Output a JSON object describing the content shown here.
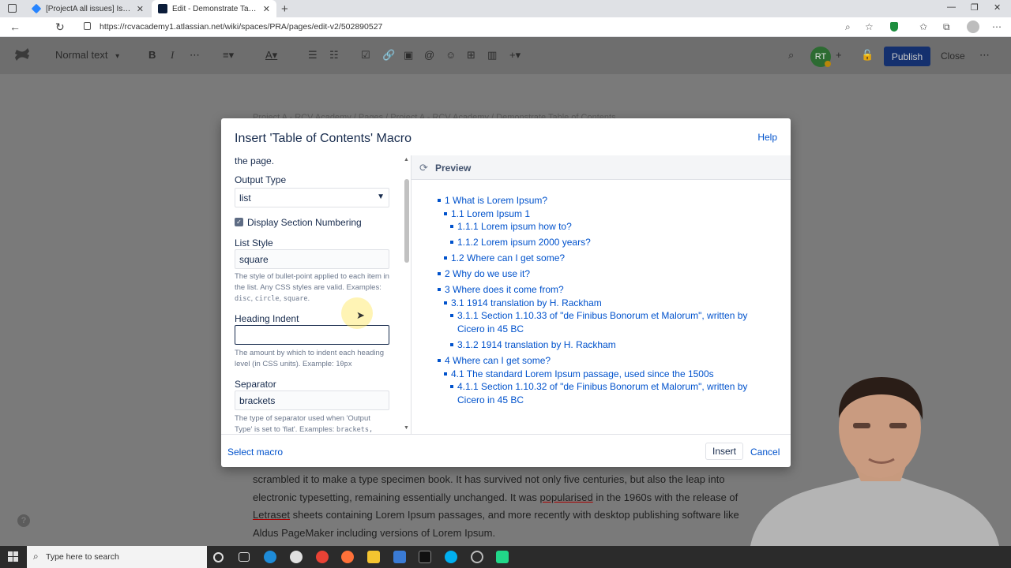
{
  "browser": {
    "tabs": [
      {
        "title": "[ProjectA all issues] Issue navigat",
        "icon": "jira-icon",
        "active": false
      },
      {
        "title": "Edit - Demonstrate Table of Cont",
        "icon": "confluence-icon",
        "active": true
      }
    ],
    "new_tab": "+",
    "url": "https://rcvacademy1.atlassian.net/wiki/spaces/PRA/pages/edit-v2/502890527"
  },
  "editor_toolbar": {
    "text_style": "Normal text",
    "avatar_initials": "RT",
    "publish_label": "Publish",
    "close_label": "Close"
  },
  "page": {
    "breadcrumb": "Project A - RCV Academy   /   Pages   /   Project A - RCV Academy   /   Demonstrate Table of Contents",
    "body_lines": [
      "scrambled it to make a type specimen book. It has survived not only five centuries, but also the leap into",
      "electronic typesetting, remaining essentially unchanged. It was ",
      "popularised",
      " in the 1960s with the release of",
      "Letraset",
      " sheets containing Lorem Ipsum passages, and more recently with desktop publishing software like",
      "Aldus PageMaker including versions of Lorem Ipsum."
    ]
  },
  "dialog": {
    "title": "Insert 'Table of Contents' Macro",
    "help_label": "Help",
    "left": {
      "top_text": "the page.",
      "output_type_label": "Output Type",
      "output_type_value": "list",
      "display_numbering_label": "Display Section Numbering",
      "display_numbering_checked": true,
      "list_style_label": "List Style",
      "list_style_value": "square",
      "list_style_hint_1": "The style of bullet-point applied to each item in the list. Any CSS styles are valid. Examples: ",
      "list_style_hint_codes": [
        "disc",
        "circle",
        "square"
      ],
      "heading_indent_label": "Heading Indent",
      "heading_indent_value": "",
      "heading_indent_hint": "The amount by which to indent each heading level (in CSS units). Example: ",
      "heading_indent_hint_code": "10px",
      "separator_label": "Separator",
      "separator_value": "brackets",
      "separator_hint": "The type of separator used when 'Output Type' is set to 'flat'. Examples: ",
      "separator_hint_code": "brackets,"
    },
    "preview_title": "Preview",
    "toc": [
      {
        "text": "1 What is Lorem Ipsum?",
        "level": 1
      },
      {
        "text": "1.1 Lorem Ipsum 1",
        "level": 2
      },
      {
        "text": "1.1.1 Lorem ipsum how to?",
        "level": 3
      },
      {
        "text": "1.1.2 Lorem ipsum 2000 years?",
        "level": 3
      },
      {
        "text": "1.2 Where can I get some?",
        "level": 2
      },
      {
        "text": "2 Why do we use it?",
        "level": 1
      },
      {
        "text": "3 Where does it come from?",
        "level": 1
      },
      {
        "text": "3.1 1914 translation by H. Rackham",
        "level": 2
      },
      {
        "text": "3.1.1 Section 1.10.33 of \"de Finibus Bonorum et Malorum\", written by",
        "text2": "Cicero in 45 BC",
        "level": 3
      },
      {
        "text": "3.1.2 1914 translation by H. Rackham",
        "level": 3
      },
      {
        "text": "4 Where can I get some?",
        "level": 1
      },
      {
        "text": "4.1 The standard Lorem Ipsum passage, used since the 1500s",
        "level": 2
      },
      {
        "text": "4.1.1 Section 1.10.32 of \"de Finibus Bonorum et Malorum\", written by",
        "text2": "Cicero in 45 BC",
        "level": 3
      }
    ],
    "footer": {
      "select_macro_label": "Select macro",
      "insert_label": "Insert",
      "cancel_label": "Cancel"
    }
  },
  "taskbar": {
    "search_placeholder": "Type here to search"
  },
  "colors": {
    "link": "#0052cc",
    "publish_bg": "#14306e",
    "text": "#172b4d"
  }
}
